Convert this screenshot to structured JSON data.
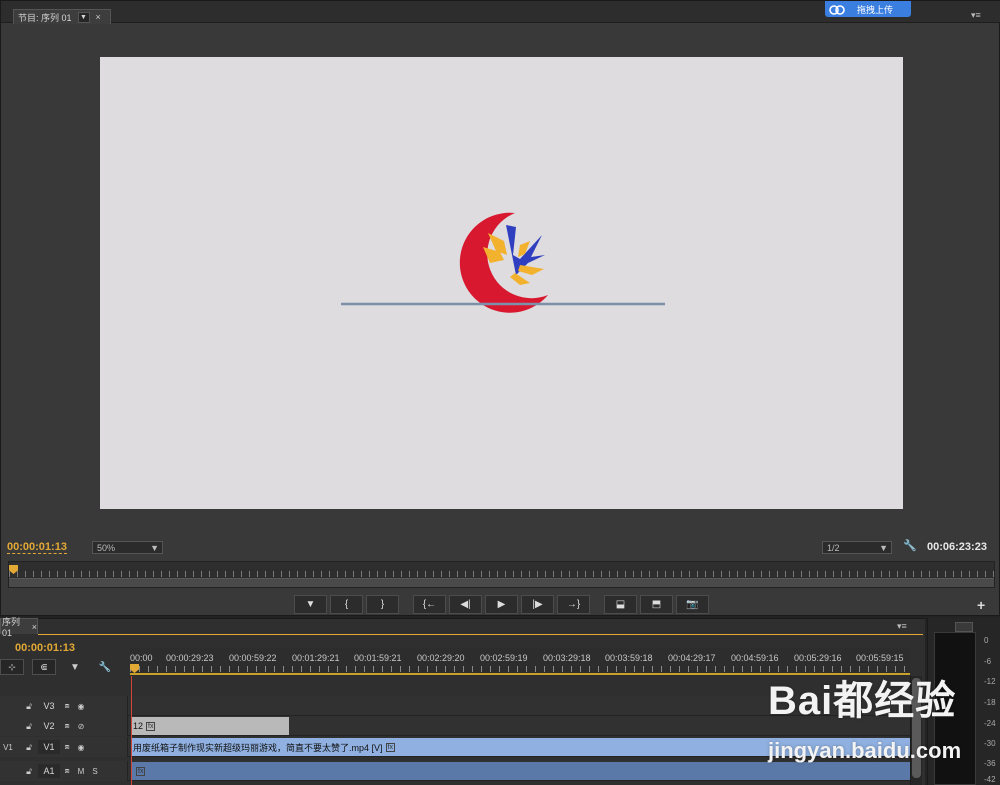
{
  "program_monitor": {
    "tab_title": "节目: 序列 01",
    "tab_dropdown": "▼",
    "tab_close": "×",
    "panel_menu": "▾≡",
    "upload_button": "拖拽上传",
    "current_time": "00:00:01:13",
    "zoom_level": "50%",
    "resolution": "1/2",
    "duration": "00:06:23:23",
    "add_button": "+",
    "buttons": [
      {
        "name": "add-marker-button",
        "glyph": "▼"
      },
      {
        "name": "mark-in-button",
        "glyph": "{"
      },
      {
        "name": "mark-out-button",
        "glyph": "}"
      },
      {
        "name": "go-to-in-button",
        "glyph": "{←"
      },
      {
        "name": "step-back-button",
        "glyph": "◀|"
      },
      {
        "name": "play-button",
        "glyph": "▶"
      },
      {
        "name": "step-forward-button",
        "glyph": "|▶"
      },
      {
        "name": "go-to-out-button",
        "glyph": "→}"
      },
      {
        "name": "lift-button",
        "glyph": "⬓"
      },
      {
        "name": "extract-button",
        "glyph": "⬒"
      },
      {
        "name": "export-frame-button",
        "glyph": "📷"
      }
    ]
  },
  "timeline": {
    "tab_title": "序列 01",
    "tab_close": "×",
    "panel_menu": "▾≡",
    "current_time": "00:00:01:13",
    "time_labels": [
      "00:00",
      "00:00:29:23",
      "00:00:59:22",
      "00:01:29:21",
      "00:01:59:21",
      "00:02:29:20",
      "00:02:59:19",
      "00:03:29:18",
      "00:03:59:18",
      "00:04:29:17",
      "00:04:59:16",
      "00:05:29:16",
      "00:05:59:15"
    ],
    "tracks": [
      {
        "name": "V3",
        "target": "",
        "clip": null
      },
      {
        "name": "V2",
        "target": "",
        "clip": {
          "label": "12",
          "color": "#b9b9b9"
        }
      },
      {
        "name": "V1",
        "target": "V1",
        "clip": {
          "label": "用废纸箱子制作现实新超级玛丽游戏，简直不要太赞了.mp4 [V]",
          "color": "#8fb0e0"
        }
      },
      {
        "name": "A1",
        "target": "",
        "clip": {
          "label": "",
          "color": "#5b79a8"
        }
      }
    ],
    "track_buttons": {
      "mute": "M",
      "solo": "S"
    },
    "fx_label": "fx"
  },
  "audio_meter": {
    "db_labels": [
      "0",
      "-6",
      "-12",
      "-18",
      "-24",
      "-30",
      "-36",
      "-42"
    ]
  },
  "watermark": {
    "brand": "Bai都经验",
    "url": "jingyan.baidu.com"
  }
}
